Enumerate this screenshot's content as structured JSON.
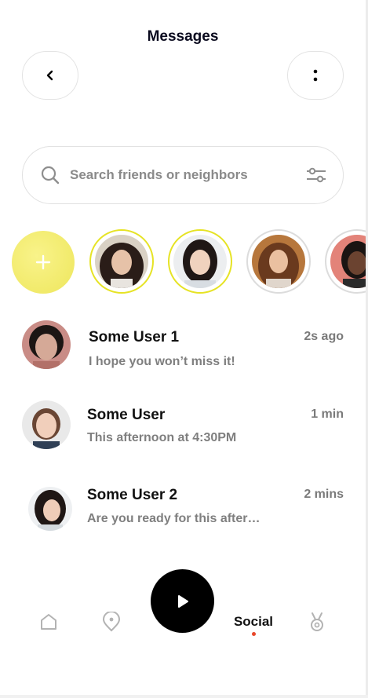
{
  "header": {
    "title": "Messages"
  },
  "search": {
    "placeholder": "Search friends or neighbors"
  },
  "stories": {
    "add_symbol": "+",
    "items": [
      {
        "ring": "yellow"
      },
      {
        "ring": "yellow"
      },
      {
        "ring": "grey"
      },
      {
        "ring": "grey"
      }
    ]
  },
  "messages": [
    {
      "name": "Some User 1",
      "time": "2s ago",
      "preview": "I hope you won’t miss it!"
    },
    {
      "name": "Some User",
      "time": "1 min",
      "preview": "This afternoon at 4:30PM"
    },
    {
      "name": "Some User 2",
      "time": "2 mins",
      "preview": "Are you ready for this after…"
    }
  ],
  "nav": {
    "items": [
      "home-icon",
      "location-icon",
      "play-icon",
      "Social",
      "award-icon"
    ],
    "social_label": "Social",
    "active": "Social"
  },
  "colors": {
    "accent_yellow": "#e6e325",
    "active_dot": "#e8472b",
    "text_muted": "#7f7f7f"
  }
}
